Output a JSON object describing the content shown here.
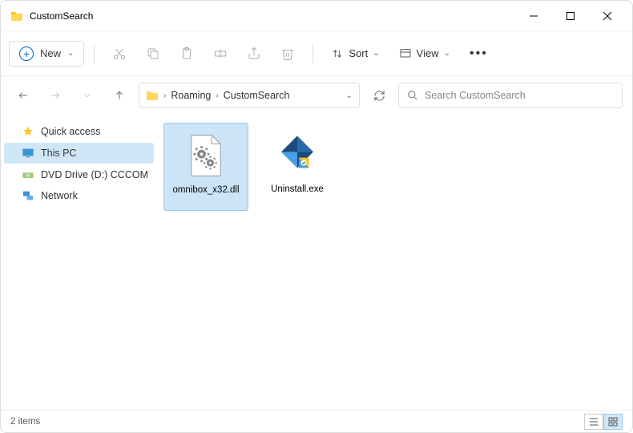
{
  "titlebar": {
    "title": "CustomSearch"
  },
  "toolbar": {
    "new_label": "New",
    "sort_label": "Sort",
    "view_label": "View"
  },
  "breadcrumb": {
    "parent": "Roaming",
    "current": "CustomSearch"
  },
  "search": {
    "placeholder": "Search CustomSearch"
  },
  "sidebar": {
    "items": [
      {
        "label": "Quick access",
        "icon": "star"
      },
      {
        "label": "This PC",
        "icon": "monitor",
        "selected": true
      },
      {
        "label": "DVD Drive (D:) CCCOM",
        "icon": "disc"
      },
      {
        "label": "Network",
        "icon": "network"
      }
    ]
  },
  "files": [
    {
      "name": "omnibox_x32.dll",
      "type": "dll",
      "selected": true
    },
    {
      "name": "Uninstall.exe",
      "type": "exe",
      "selected": false
    }
  ],
  "statusbar": {
    "count_text": "2 items"
  }
}
